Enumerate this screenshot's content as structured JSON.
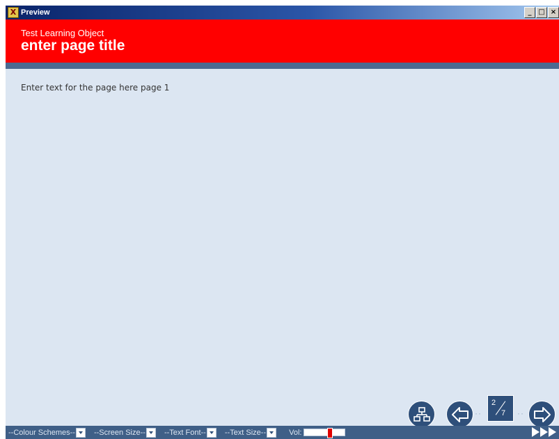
{
  "window": {
    "title": "Preview",
    "app_icon_glyph": "X",
    "minimize_glyph": "_",
    "maximize_glyph": "□",
    "close_glyph": "×"
  },
  "header": {
    "lo_title": "Test Learning Object",
    "page_title": "enter page title",
    "color": "#ff0000"
  },
  "content": {
    "text": "Enter text for the page here page 1"
  },
  "navigation": {
    "page_current": "2",
    "page_total": "7",
    "icons": [
      "sitemap-icon",
      "back-arrow-icon",
      "forward-arrow-icon"
    ]
  },
  "footer": {
    "colour_schemes": "--Colour Schemes--",
    "screen_size": "--Screen Size--",
    "text_font": "--Text Font--",
    "text_size": "--Text Size--",
    "vol_label": "Vol:",
    "volume_level": 0.65,
    "skip_icon": "skip-to-end-icon"
  }
}
